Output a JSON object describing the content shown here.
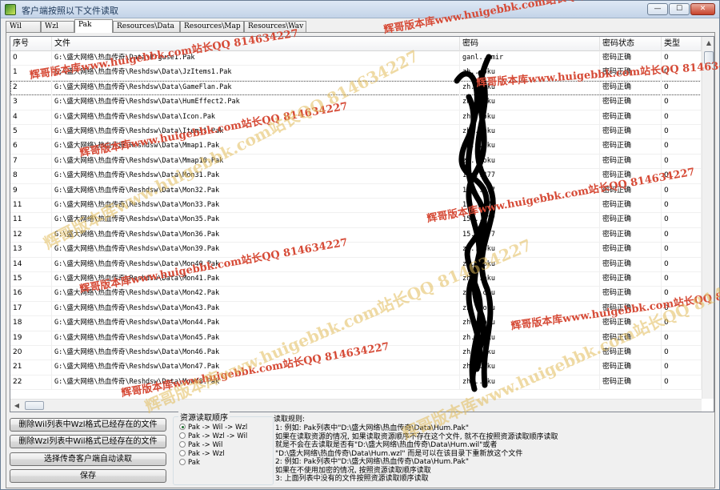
{
  "window": {
    "title": "客户端按照以下文件读取",
    "min_glyph": "—",
    "max_glyph": "☐",
    "close_glyph": "✕"
  },
  "tabs": [
    {
      "label": "Wil",
      "active": false
    },
    {
      "label": "Wzl",
      "active": false
    },
    {
      "label": "Pak",
      "active": true
    },
    {
      "label": "Resources\\Data",
      "active": false
    },
    {
      "label": "Resources\\Map",
      "active": false
    },
    {
      "label": "Resources\\Wav",
      "active": false
    }
  ],
  "table": {
    "columns": [
      "序号",
      "文件",
      "密码",
      "密码状态",
      "类型"
    ],
    "rows": [
      [
        "0",
        "G:\\盛大网络\\热血传奇\\Data\\Prguse1.Pak",
        "ganl...mir",
        "密码正确",
        "0"
      ],
      [
        "1",
        "G:\\盛大网络\\热血传奇\\Reshdsw\\Data\\JzItems1.Pak",
        "zh...oku",
        "密码正确",
        "0"
      ],
      [
        "2",
        "G:\\盛大网络\\热血传奇\\Reshdsw\\Data\\GameFlan.Pak",
        "zh...oku",
        "密码正确",
        "0"
      ],
      [
        "3",
        "G:\\盛大网络\\热血传奇\\Reshdsw\\Data\\HumEffect2.Pak",
        "zh...oku",
        "密码正确",
        "0"
      ],
      [
        "4",
        "G:\\盛大网络\\热血传奇\\Reshdsw\\Data\\Icon.Pak",
        "zh...oku",
        "密码正确",
        "0"
      ],
      [
        "5",
        "G:\\盛大网络\\热血传奇\\Reshdsw\\Data\\Items1.Pak",
        "zh...oku",
        "密码正确",
        "0"
      ],
      [
        "6",
        "G:\\盛大网络\\热血传奇\\Reshdsw\\Data\\Mmap1.Pak",
        "zh...oku",
        "密码正确",
        "0"
      ],
      [
        "7",
        "G:\\盛大网络\\热血传奇\\Reshdsw\\Data\\Mmap10.Pak",
        "zh...oku",
        "密码正确",
        "0"
      ],
      [
        "8",
        "G:\\盛大网络\\热血传奇\\Reshdsw\\Data\\Mon31.Pak",
        "15...477",
        "密码正确",
        "0"
      ],
      [
        "9",
        "G:\\盛大网络\\热血传奇\\Reshdsw\\Data\\Mon32.Pak",
        "15...477",
        "密码正确",
        "0"
      ],
      [
        "11",
        "G:\\盛大网络\\热血传奇\\Reshdsw\\Data\\Mon33.Pak",
        "15...477",
        "密码正确",
        "0"
      ],
      [
        "11",
        "G:\\盛大网络\\热血传奇\\Reshdsw\\Data\\Mon35.Pak",
        "15...477",
        "密码正确",
        "0"
      ],
      [
        "12",
        "G:\\盛大网络\\热血传奇\\Reshdsw\\Data\\Mon36.Pak",
        "15...477",
        "密码正确",
        "0"
      ],
      [
        "13",
        "G:\\盛大网络\\热血传奇\\Reshdsw\\Data\\Mon39.Pak",
        "zh...oku",
        "密码正确",
        "0"
      ],
      [
        "14",
        "G:\\盛大网络\\热血传奇\\Reshdsw\\Data\\Mon40.Pak",
        "zh...oku",
        "密码正确",
        "0"
      ],
      [
        "15",
        "G:\\盛大网络\\热血传奇\\Reshdsw\\Data\\Mon41.Pak",
        "zh...oku",
        "密码正确",
        "0"
      ],
      [
        "16",
        "G:\\盛大网络\\热血传奇\\Reshdsw\\Data\\Mon42.Pak",
        "zh...oku",
        "密码正确",
        "0"
      ],
      [
        "17",
        "G:\\盛大网络\\热血传奇\\Reshdsw\\Data\\Mon43.Pak",
        "zh...oku",
        "密码正确",
        "0"
      ],
      [
        "18",
        "G:\\盛大网络\\热血传奇\\Reshdsw\\Data\\Mon44.Pak",
        "zh...oku",
        "密码正确",
        "0"
      ],
      [
        "19",
        "G:\\盛大网络\\热血传奇\\Reshdsw\\Data\\Mon45.Pak",
        "zh...oku",
        "密码正确",
        "0"
      ],
      [
        "20",
        "G:\\盛大网络\\热血传奇\\Reshdsw\\Data\\Mon46.Pak",
        "zh...oku",
        "密码正确",
        "0"
      ],
      [
        "21",
        "G:\\盛大网络\\热血传奇\\Reshdsw\\Data\\Mon47.Pak",
        "zh...oku",
        "密码正确",
        "0"
      ],
      [
        "22",
        "G:\\盛大网络\\热血传奇\\Reshdsw\\Data\\Mon48.Pak",
        "zh...oku",
        "密码正确",
        "0"
      ]
    ],
    "scroll_up_glyph": "▲",
    "scroll_left_glyph": "◀"
  },
  "buttons": {
    "delete_wil": "删除Wil列表中Wzl格式已经存在的文件",
    "delete_wzl": "删除Wzl列表中Wil格式已经存在的文件",
    "auto_read": "选择传奇客户端自动读取",
    "save": "保存"
  },
  "read_order": {
    "title": "资源读取顺序",
    "options": [
      {
        "label": "Pak -> Wil -> Wzl",
        "selected": true
      },
      {
        "label": "Pak -> Wzl -> Wil",
        "selected": false
      },
      {
        "label": "Pak -> Wil",
        "selected": false
      },
      {
        "label": "Pak -> Wzl",
        "selected": false
      },
      {
        "label": "Pak",
        "selected": false
      }
    ]
  },
  "rules": {
    "title": "读取规则:",
    "lines": [
      "1: 例如: Pak列表中\"D:\\盛大网络\\热血传奇\\Data\\Hum.Pak\"",
      "    如果在读取资源的情况, 如果读取资源顺序不存在这个文件, 就不在按照资源读取顺序读取",
      "    就是不会在去读取是否有\"D:\\盛大网络\\热血传奇\\Data\\Hum.wil\"或者",
      "    \"D:\\盛大网络\\热血传奇\\Data\\Hum.wzl\"  而是可以在该目录下重新放这个文件",
      "2: 例如: Pak列表中\"D:\\盛大网络\\热血传奇\\Data\\Hum.Pak\"",
      "    如果在不使用加密的情况, 按照资源读取顺序读取",
      "3: 上面列表中没有的文件按照资源读取顺序读取"
    ]
  },
  "watermarks": [
    "辉哥版本库www.huigebbk.com站长QQ 814634227"
  ]
}
